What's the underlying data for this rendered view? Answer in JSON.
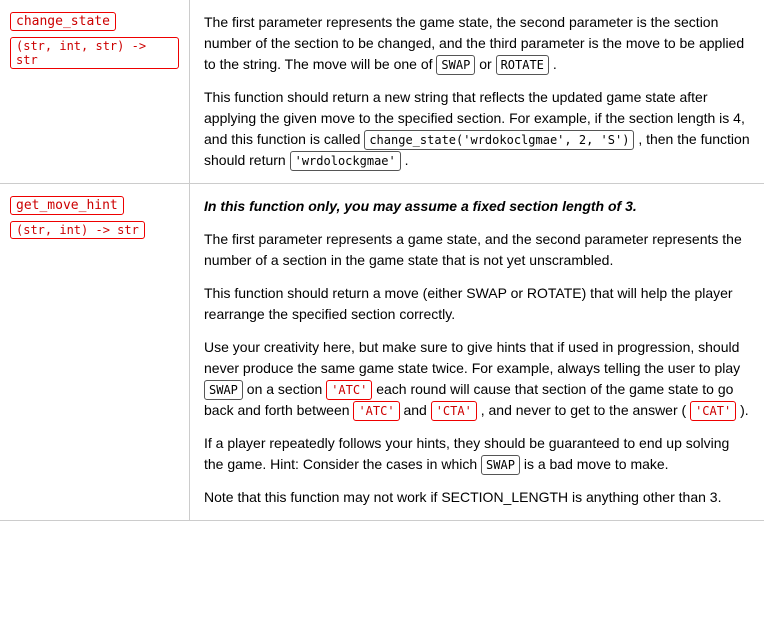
{
  "row1": {
    "func_name": "change_state",
    "func_sig": "(str, int, str) -> str",
    "paras": [
      "The first parameter represents the game state, the second parameter is the section number of the section to be changed, and the third parameter is the move to be applied to the string. The move will be one of",
      "or",
      ".",
      "This function should return a new string that reflects the updated game state after applying the given move to the specified section. For example, if the section length is 4, and this function is called",
      ", then the function should return",
      "."
    ],
    "swap_code": "SWAP",
    "rotate_code": "ROTATE",
    "example_call": "change_state('wrdokoclgmae', 2, 'S')",
    "example_return": "'wrdolockgmae'"
  },
  "row2": {
    "func_name": "get_move_hint",
    "func_sig": "(str, int) -> str",
    "italic_bold": "In this function only, you may assume a fixed section length of 3.",
    "paras": [
      "The first parameter represents a game state, and the second parameter represents the number of a section in the game state that is not yet unscrambled.",
      "This function should return a move (either SWAP or ROTATE) that will help the player rearrange the specified section correctly.",
      "Use your creativity here, but make sure to give hints that if used in progression, should never produce the same game state twice. For example, always telling the user to play",
      "on a section",
      "each round will cause that section of the game state to go back and forth between",
      "and",
      ", and never to get to the answer (",
      ").",
      "If a player repeatedly follows your hints, they should be guaranteed to end up solving the game. Hint: Consider the cases in which",
      "is a bad move to make.",
      "Note that this function may not work if SECTION_LENGTH is anything other than 3."
    ],
    "swap_code": "SWAP",
    "atc_code": "'ATC'",
    "atc_code2": "'ATC'",
    "cta_code": "'CTA'",
    "cat_code": "'CAT'",
    "swap_code2": "SWAP"
  }
}
